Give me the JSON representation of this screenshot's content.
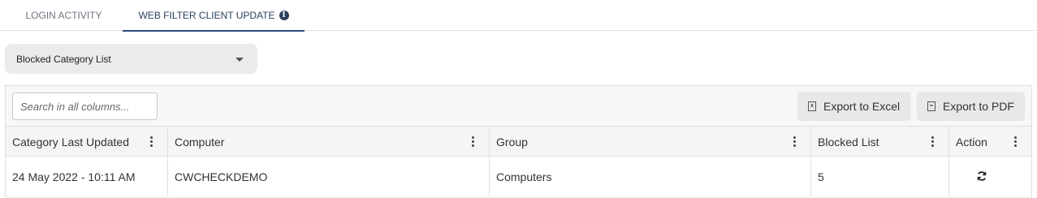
{
  "tabs": [
    {
      "label": "LOGIN ACTIVITY"
    },
    {
      "label": "WEB FILTER CLIENT UPDATE",
      "active": true
    }
  ],
  "report_select": {
    "value": "Blocked Category List"
  },
  "search": {
    "placeholder": "Search in all columns..."
  },
  "toolbar": {
    "export_excel": "Export to Excel",
    "export_pdf": "Export to PDF"
  },
  "columns": [
    "Category Last Updated",
    "Computer",
    "Group",
    "Blocked List",
    "Action"
  ],
  "rows": [
    {
      "category_last_updated": "24 May 2022 - 10:11 AM",
      "computer": "CWCHECKDEMO",
      "group": "Computers",
      "blocked_list": "5",
      "action_icon": "refresh-icon"
    }
  ],
  "colors": {
    "accent": "#2b4a7a",
    "tab_active_text": "#2b3f5c"
  }
}
